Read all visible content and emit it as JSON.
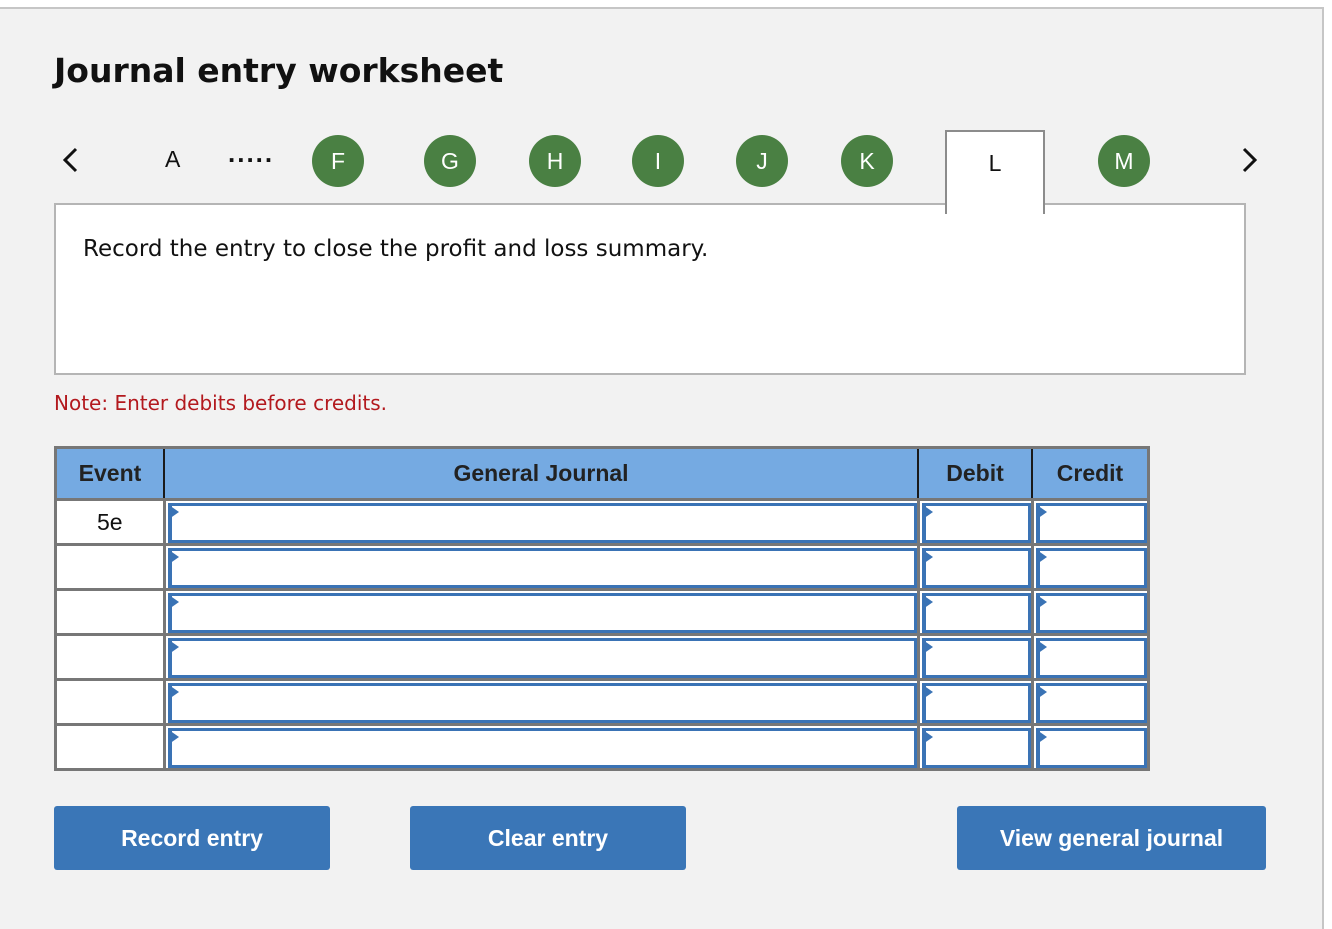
{
  "title": "Journal entry worksheet",
  "tabs": {
    "prev_icon": "chevron-left-icon",
    "next_icon": "chevron-right-icon",
    "first": "A",
    "ellipsis": ".....",
    "items": [
      {
        "label": "F",
        "status": "completed"
      },
      {
        "label": "G",
        "status": "completed"
      },
      {
        "label": "H",
        "status": "completed"
      },
      {
        "label": "I",
        "status": "completed"
      },
      {
        "label": "J",
        "status": "completed"
      },
      {
        "label": "K",
        "status": "completed"
      },
      {
        "label": "L",
        "status": "active"
      },
      {
        "label": "M",
        "status": "completed"
      }
    ],
    "completed_color": "#4a8043"
  },
  "question": "Record the entry to close the profit and loss summary.",
  "note": "Note: Enter debits before credits.",
  "table": {
    "headers": {
      "event": "Event",
      "general_journal": "General Journal",
      "debit": "Debit",
      "credit": "Credit"
    },
    "rows": [
      {
        "event": "5e",
        "account": "",
        "debit": "",
        "credit": ""
      },
      {
        "event": "",
        "account": "",
        "debit": "",
        "credit": ""
      },
      {
        "event": "",
        "account": "",
        "debit": "",
        "credit": ""
      },
      {
        "event": "",
        "account": "",
        "debit": "",
        "credit": ""
      },
      {
        "event": "",
        "account": "",
        "debit": "",
        "credit": ""
      },
      {
        "event": "",
        "account": "",
        "debit": "",
        "credit": ""
      }
    ],
    "header_color": "#75aae2"
  },
  "buttons": {
    "record": "Record entry",
    "clear": "Clear entry",
    "view": "View general journal",
    "color": "#3a76b7"
  }
}
